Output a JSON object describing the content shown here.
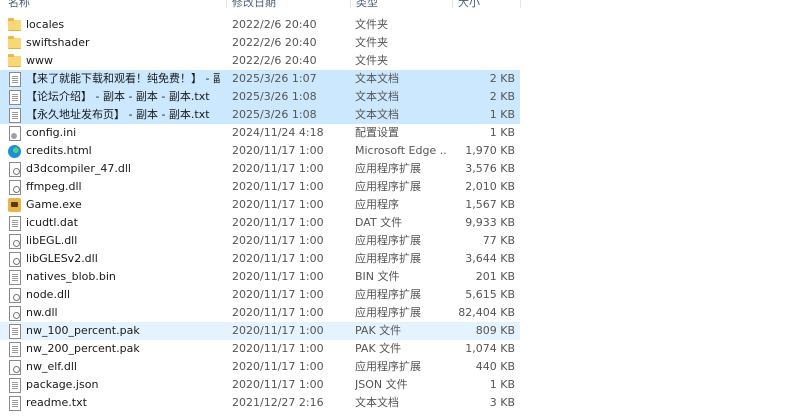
{
  "header": {
    "name": "名称",
    "date": "修改日期",
    "type": "类型",
    "size": "大小"
  },
  "files": [
    {
      "name": "locales",
      "date": "2022/2/6 20:40",
      "type": "文件夹",
      "size": "",
      "icon": "folder-icon",
      "state": ""
    },
    {
      "name": "swiftshader",
      "date": "2022/2/6 20:40",
      "type": "文件夹",
      "size": "",
      "icon": "folder-icon",
      "state": ""
    },
    {
      "name": "www",
      "date": "2022/2/6 20:40",
      "type": "文件夹",
      "size": "",
      "icon": "folder-icon",
      "state": ""
    },
    {
      "name": "【来了就能下载和观看！纯免费！】 - 副...",
      "date": "2025/3/26 1:07",
      "type": "文本文档",
      "size": "2 KB",
      "icon": "text-file-icon",
      "state": "selected"
    },
    {
      "name": "【论坛介绍】 - 副本 - 副本 - 副本.txt",
      "date": "2025/3/26 1:08",
      "type": "文本文档",
      "size": "2 KB",
      "icon": "text-file-icon",
      "state": "selected"
    },
    {
      "name": "【永久地址发布页】 - 副本 - 副本.txt",
      "date": "2025/3/26 1:08",
      "type": "文本文档",
      "size": "1 KB",
      "icon": "text-file-icon",
      "state": "selected"
    },
    {
      "name": "config.ini",
      "date": "2024/11/24 4:18",
      "type": "配置设置",
      "size": "1 KB",
      "icon": "settings-file-icon",
      "state": ""
    },
    {
      "name": "credits.html",
      "date": "2020/11/17 1:00",
      "type": "Microsoft Edge ...",
      "size": "1,970 KB",
      "icon": "edge-icon",
      "state": ""
    },
    {
      "name": "d3dcompiler_47.dll",
      "date": "2020/11/17 1:00",
      "type": "应用程序扩展",
      "size": "3,576 KB",
      "icon": "dll-file-icon",
      "state": ""
    },
    {
      "name": "ffmpeg.dll",
      "date": "2020/11/17 1:00",
      "type": "应用程序扩展",
      "size": "2,010 KB",
      "icon": "dll-file-icon",
      "state": ""
    },
    {
      "name": "Game.exe",
      "date": "2020/11/17 1:00",
      "type": "应用程序",
      "size": "1,567 KB",
      "icon": "game-exe-icon",
      "state": ""
    },
    {
      "name": "icudtl.dat",
      "date": "2020/11/17 1:00",
      "type": "DAT 文件",
      "size": "9,933 KB",
      "icon": "file-icon",
      "state": ""
    },
    {
      "name": "libEGL.dll",
      "date": "2020/11/17 1:00",
      "type": "应用程序扩展",
      "size": "77 KB",
      "icon": "dll-file-icon",
      "state": ""
    },
    {
      "name": "libGLESv2.dll",
      "date": "2020/11/17 1:00",
      "type": "应用程序扩展",
      "size": "3,644 KB",
      "icon": "dll-file-icon",
      "state": ""
    },
    {
      "name": "natives_blob.bin",
      "date": "2020/11/17 1:00",
      "type": "BIN 文件",
      "size": "201 KB",
      "icon": "file-icon",
      "state": ""
    },
    {
      "name": "node.dll",
      "date": "2020/11/17 1:00",
      "type": "应用程序扩展",
      "size": "5,615 KB",
      "icon": "dll-file-icon",
      "state": ""
    },
    {
      "name": "nw.dll",
      "date": "2020/11/17 1:00",
      "type": "应用程序扩展",
      "size": "82,404 KB",
      "icon": "dll-file-icon",
      "state": ""
    },
    {
      "name": "nw_100_percent.pak",
      "date": "2020/11/17 1:00",
      "type": "PAK 文件",
      "size": "809 KB",
      "icon": "file-icon",
      "state": "hover"
    },
    {
      "name": "nw_200_percent.pak",
      "date": "2020/11/17 1:00",
      "type": "PAK 文件",
      "size": "1,074 KB",
      "icon": "file-icon",
      "state": ""
    },
    {
      "name": "nw_elf.dll",
      "date": "2020/11/17 1:00",
      "type": "应用程序扩展",
      "size": "440 KB",
      "icon": "dll-file-icon",
      "state": ""
    },
    {
      "name": "package.json",
      "date": "2020/11/17 1:00",
      "type": "JSON 文件",
      "size": "1 KB",
      "icon": "file-icon",
      "state": ""
    },
    {
      "name": "readme.txt",
      "date": "2021/12/27 2:16",
      "type": "文本文档",
      "size": "3 KB",
      "icon": "text-file-icon",
      "state": ""
    }
  ]
}
